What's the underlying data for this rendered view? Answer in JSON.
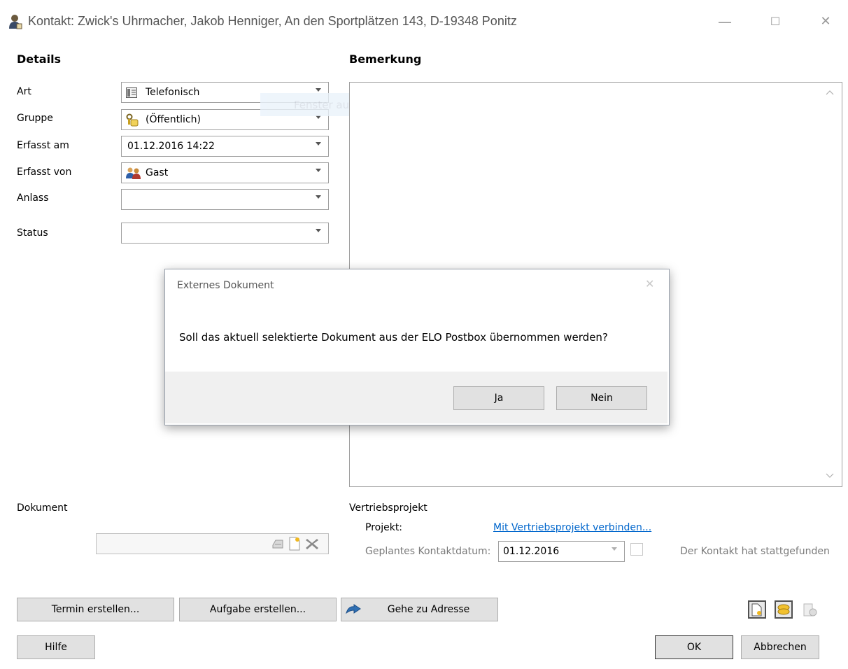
{
  "window": {
    "title": "Kontakt: Zwick's Uhrmacher, Jakob Henniger, An den Sportplätzen 143, D-19348 Ponitz",
    "controls": {
      "minimize": "—",
      "maximize": "☐",
      "close": "✕"
    }
  },
  "details": {
    "heading": "Details",
    "fields": {
      "art": {
        "label": "Art",
        "value": "Telefonisch",
        "icon": "phone-list-icon"
      },
      "gruppe": {
        "label": "Gruppe",
        "value": "(Öffentlich)",
        "icon": "group-key-icon"
      },
      "erfasst_am": {
        "label": "Erfasst am",
        "value": "01.12.2016 14:22"
      },
      "erfasst_von": {
        "label": "Erfasst von",
        "value": "Gast",
        "icon": "users-icon"
      },
      "anlass": {
        "label": "Anlass",
        "value": ""
      },
      "status": {
        "label": "Status",
        "value": ""
      }
    }
  },
  "bemerkung": {
    "heading": "Bemerkung",
    "ghost_tooltip": "Fenster ausschneiden"
  },
  "dialog": {
    "title": "Externes Dokument",
    "message": "Soll das aktuell selektierte Dokument aus der ELO Postbox übernommen werden?",
    "yes_label": "Ja",
    "no_label": "Nein",
    "close": "✕"
  },
  "dokument": {
    "label": "Dokument",
    "value": ""
  },
  "vertrieb": {
    "heading": "Vertriebsprojekt",
    "projekt_label": "Projekt:",
    "projekt_link": "Mit Vertriebsprojekt verbinden...",
    "kontaktdatum_label": "Geplantes Kontaktdatum:",
    "kontaktdatum_value": "01.12.2016",
    "stattgefunden_label": "Der Kontakt hat stattgefunden"
  },
  "buttons": {
    "termin": "Termin erstellen...",
    "aufgabe": "Aufgabe erstellen...",
    "adresse": "Gehe zu Adresse",
    "hilfe": "Hilfe",
    "ok": "OK",
    "abbrechen": "Abbrechen"
  },
  "colors": {
    "accent_link": "#0066cc",
    "dialog_footer": "#f0f0f0",
    "button_bg": "#e1e1e1"
  }
}
